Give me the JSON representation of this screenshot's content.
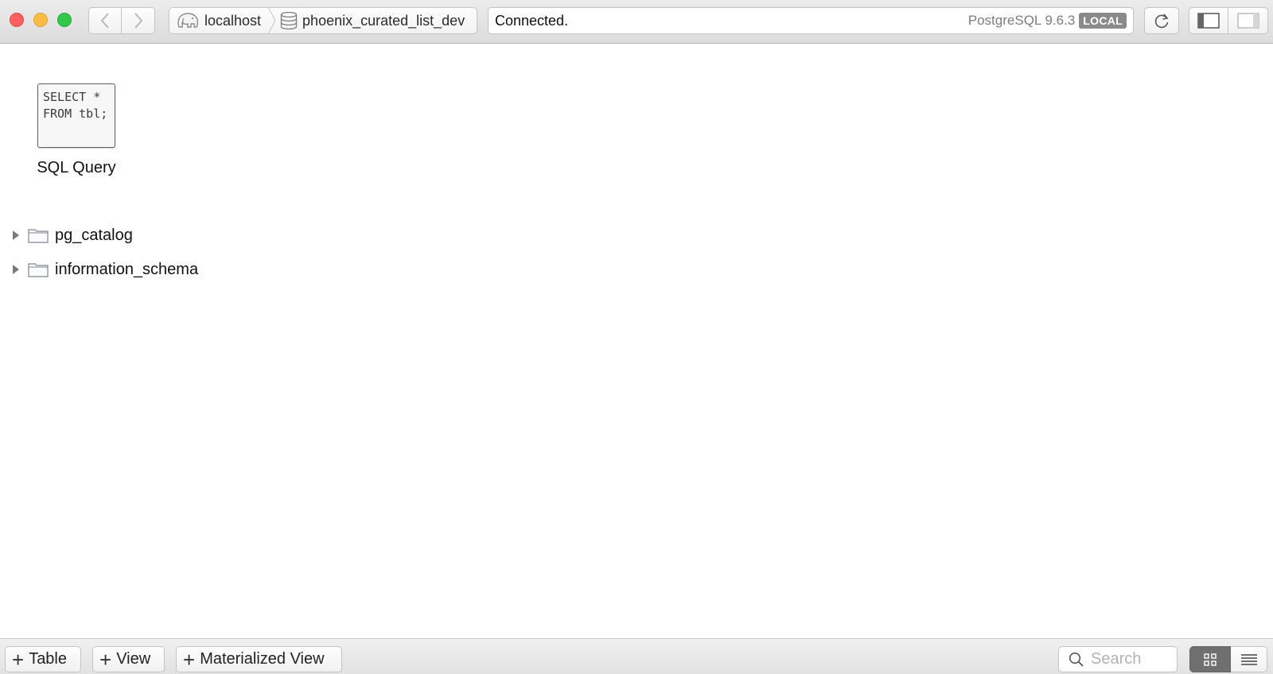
{
  "toolbar": {
    "host": "localhost",
    "database": "phoenix_curated_list_dev",
    "status": "Connected.",
    "server_version": "PostgreSQL 9.6.3",
    "badge": "LOCAL"
  },
  "main": {
    "query_tile": {
      "code": "SELECT *\nFROM tbl;",
      "label": "SQL Query"
    },
    "schemas": [
      {
        "name": "pg_catalog"
      },
      {
        "name": "information_schema"
      }
    ]
  },
  "bottom": {
    "add_table": "Table",
    "add_view": "View",
    "add_materialized_view": "Materialized View",
    "search_placeholder": "Search"
  },
  "colors": {
    "close": "#fc605c",
    "minimize": "#fdbc40",
    "maximize": "#34c84a",
    "badge_bg": "#8a8a8a"
  },
  "icons": {
    "host": "elephant-icon",
    "database": "database-icon",
    "schema": "folder-icon"
  }
}
